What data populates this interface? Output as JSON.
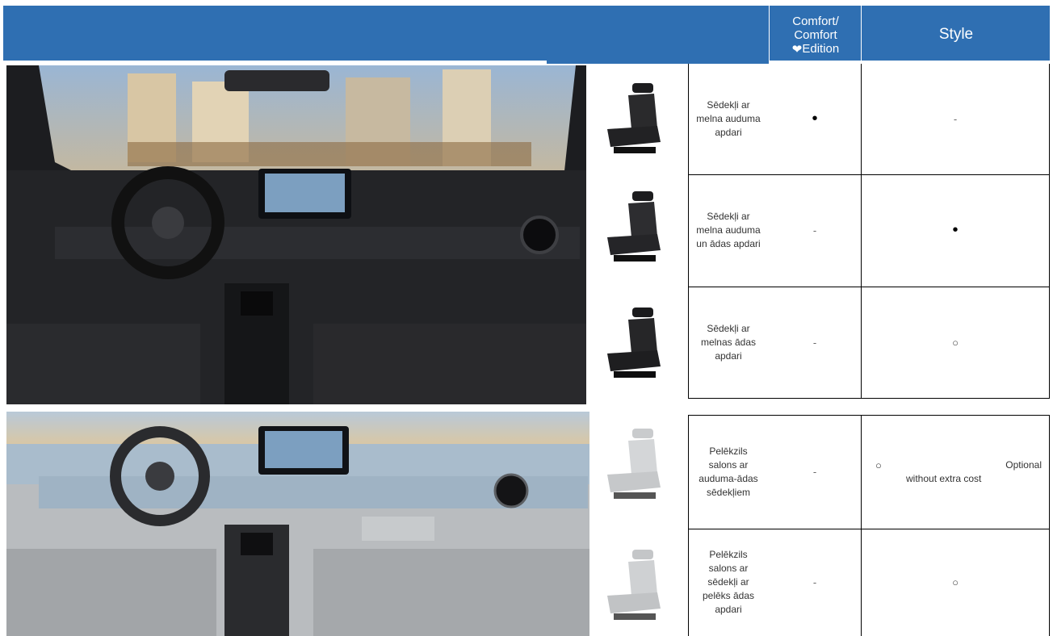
{
  "header": {
    "col_comfort": "Comfort/ Comfort",
    "col_comfort_heart": "❤",
    "col_comfort_edition": "Edition",
    "col_style": "Style"
  },
  "rows": [
    {
      "desc": "Sēdekļi ar melna auduma apdari",
      "comfort": "•",
      "style": "-"
    },
    {
      "desc": "Sēdekļi ar melna auduma un ādas apdari",
      "comfort": "-",
      "style": "•"
    },
    {
      "desc": "Sēdekļi ar melnas ādas apdari",
      "comfort": "-",
      "style": "○"
    },
    {
      "desc": "Pelēkzils salons ar auduma-ādas sēdekļiem",
      "comfort": "-",
      "style": "○",
      "style_note_1": "Optional",
      "style_note_2": "without extra cost"
    },
    {
      "desc": "Pelēkzils salons ar sēdekļi ar pelēks ādas apdari",
      "comfort": "-",
      "style": "○"
    }
  ],
  "colors": {
    "header": "#2f6fb2",
    "text_on_header": "#ffffff"
  }
}
